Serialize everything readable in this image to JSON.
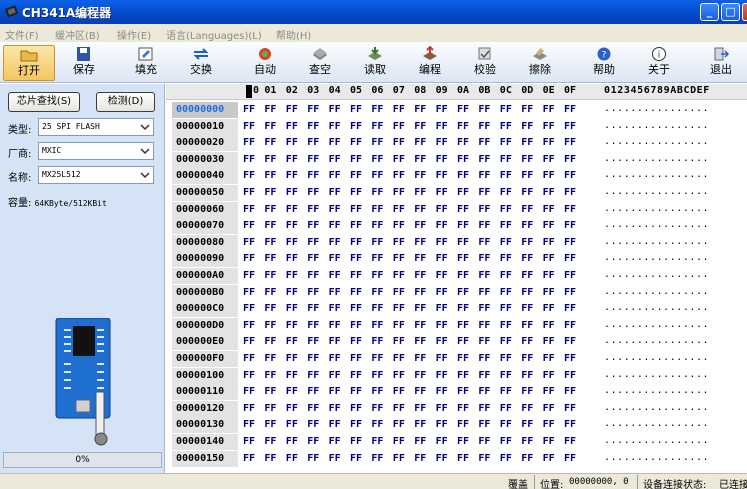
{
  "window": {
    "title": "CH341A编程器",
    "min": "_",
    "max": "□",
    "close": "×"
  },
  "menu": [
    "文件(F)",
    "缓冲区(B)",
    "操作(E)",
    "语言(Languages)(L)",
    "帮助(H)"
  ],
  "toolbar": [
    {
      "label": "打开",
      "icon": "open-folder-icon",
      "active": true
    },
    {
      "label": "保存",
      "icon": "save-disk-icon"
    },
    {
      "label": "填充",
      "icon": "fill-icon"
    },
    {
      "label": "交换",
      "icon": "swap-icon"
    },
    {
      "label": "自动",
      "icon": "auto-icon"
    },
    {
      "label": "查空",
      "icon": "blank-check-icon"
    },
    {
      "label": "读取",
      "icon": "read-icon"
    },
    {
      "label": "编程",
      "icon": "program-icon"
    },
    {
      "label": "校验",
      "icon": "verify-icon"
    },
    {
      "label": "擦除",
      "icon": "erase-icon"
    },
    {
      "label": "帮助",
      "icon": "help-icon"
    },
    {
      "label": "关于",
      "icon": "about-icon"
    },
    {
      "label": "退出",
      "icon": "exit-icon"
    }
  ],
  "panel": {
    "find_chip": "芯片查找(S)",
    "detect": "检测(D)",
    "type_label": "类型:",
    "type_value": "25 SPI FLASH",
    "vendor_label": "厂商:",
    "vendor_value": "MXIC",
    "name_label": "名称:",
    "name_value": "MX25L512",
    "capacity_label": "容量:",
    "capacity_value": "64KByte/512KBit",
    "progress": "0%"
  },
  "hex": {
    "columns": [
      "0",
      "01",
      "02",
      "03",
      "04",
      "05",
      "06",
      "07",
      "08",
      "09",
      "0A",
      "0B",
      "0C",
      "0D",
      "0E",
      "0F"
    ],
    "ascii_header": "0123456789ABCDEF",
    "fill_byte": "FF",
    "ascii_fill": "................",
    "rows": [
      "00000000",
      "00000010",
      "00000020",
      "00000030",
      "00000040",
      "00000050",
      "00000060",
      "00000070",
      "00000080",
      "00000090",
      "000000A0",
      "000000B0",
      "000000C0",
      "000000D0",
      "000000E0",
      "000000F0",
      "00000100",
      "00000110",
      "00000120",
      "00000130",
      "00000140",
      "00000150"
    ],
    "selected_row": 0
  },
  "status": {
    "mode": "覆盖",
    "position_label": "位置:",
    "position_value": "00000000, 0",
    "device_label": "设备连接状态:",
    "device_value": "已连接"
  },
  "colors": {
    "title": "#0348c9",
    "hex_text": "#00007a",
    "panel_bg": "#d4e3f6"
  }
}
